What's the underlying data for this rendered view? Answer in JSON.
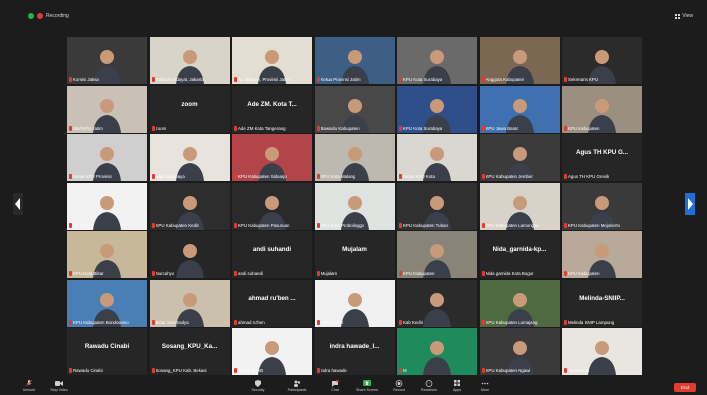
{
  "recording": {
    "label": "Recording"
  },
  "view": {
    "label": "View"
  },
  "participants": [
    {
      "name": "Komisi Jaksa",
      "display": "",
      "bg": "#3a3a3a"
    },
    {
      "name": "Rahmat Hidayat, Jakarta",
      "display": "",
      "bg": "#d9d4ca"
    },
    {
      "name": "AL Wilayah, Provinsi Jatim",
      "display": "",
      "bg": "#e3ddd2"
    },
    {
      "name": "Ketua Provinsi Jatim",
      "display": "",
      "bg": "#3d5f86"
    },
    {
      "name": "KPU Kota Surabaya",
      "display": "",
      "bg": "#6a6a6a"
    },
    {
      "name": "Anggota Kabupaten",
      "display": "",
      "bg": "#7c6852"
    },
    {
      "name": "Sekretaris KPU",
      "display": "",
      "bg": "#2b2b2b"
    },
    {
      "name": "Staf KPU Jatim",
      "display": "",
      "bg": "#c9c1b5"
    },
    {
      "name": "zoom",
      "display": "zoom",
      "bg": "#262626"
    },
    {
      "name": "Ade ZM Kota Tangerang",
      "display": "Ade ZM. Kota T...",
      "bg": "#262626"
    },
    {
      "name": "Bawaslu Kabupaten",
      "display": "",
      "bg": "#484848"
    },
    {
      "name": "KPU Kota Surabaya",
      "display": "",
      "bg": "#2f4f8a"
    },
    {
      "name": "KPU Jawa Barat",
      "display": "",
      "bg": "#3f70b0"
    },
    {
      "name": "KPU Kabupaten",
      "display": "",
      "bg": "#9b8f80"
    },
    {
      "name": "Ketua KPU Provinsi",
      "display": "",
      "bg": "#cfcfcf"
    },
    {
      "name": "Iwan Surabaya",
      "display": "",
      "bg": "#e8e3dc"
    },
    {
      "name": "KPU Kabupaten Sidoarjo",
      "display": "",
      "bg": "#b2444a"
    },
    {
      "name": "KPU Kota Malang",
      "display": "",
      "bg": "#bdb8b0"
    },
    {
      "name": "Ketua KPU Kota",
      "display": "",
      "bg": "#dad6d0"
    },
    {
      "name": "KPU Kabupaten Jember",
      "display": "",
      "bg": "#3b3b3b"
    },
    {
      "name": "Agus TH KPU Gresik",
      "display": "Agus TH KPU G...",
      "bg": "#262626"
    },
    {
      "name": "KPU RI",
      "display": "",
      "bg": "#f2f2f2"
    },
    {
      "name": "KPU Kabupaten Kediri",
      "display": "",
      "bg": "#2d2d2d"
    },
    {
      "name": "KPU Kabupaten Pasuruan",
      "display": "",
      "bg": "#2a2a2a"
    },
    {
      "name": "KPU Kota Probolinggo",
      "display": "",
      "bg": "#dfe3df"
    },
    {
      "name": "KPU Kabupaten Tuban",
      "display": "",
      "bg": "#303030"
    },
    {
      "name": "KPU Kabupaten Lamongan",
      "display": "",
      "bg": "#d8d2c8"
    },
    {
      "name": "KPU Kabupaten Mojokerto",
      "display": "",
      "bg": "#3a3a3a"
    },
    {
      "name": "KPU Kota Blitar",
      "display": "",
      "bg": "#c8b89a"
    },
    {
      "name": "Nurcahyo",
      "display": "",
      "bg": "#262626"
    },
    {
      "name": "andi suhandi",
      "display": "andi suhandi",
      "bg": "#262626"
    },
    {
      "name": "Mujalam",
      "display": "Mujalam",
      "bg": "#262626"
    },
    {
      "name": "KPU Kabupaten",
      "display": "",
      "bg": "#8a8378"
    },
    {
      "name": "Nida garnida Kota Bogor",
      "display": "Nida_garnida-kp...",
      "bg": "#262626"
    },
    {
      "name": "KPU Kabupaten",
      "display": "",
      "bg": "#b8a99a"
    },
    {
      "name": "KPU Kabupaten Bondowoso",
      "display": "",
      "bg": "#4a7fb5"
    },
    {
      "name": "Bidar Sinkmadya",
      "display": "",
      "bg": "#cbbfae"
    },
    {
      "name": "ahmad ru'ben",
      "display": "ahmad ru'ben ...",
      "bg": "#262626"
    },
    {
      "name": "Teknis KPU",
      "display": "",
      "bg": "#f0f0f0"
    },
    {
      "name": "Kab Kediri",
      "display": "",
      "bg": "#2b2b2b"
    },
    {
      "name": "KPU Kabupaten Lumajang",
      "display": "",
      "bg": "#4f6a3e"
    },
    {
      "name": "Melinda SNIP Lampung",
      "display": "Melinda-SNIIP...",
      "bg": "#262626"
    },
    {
      "name": "Rawadu Cinabi",
      "display": "Rawadu Cinabi",
      "bg": "#262626"
    },
    {
      "name": "Sosang_KPU Kab. Bekasi",
      "display": "Sosang_KPU_Ka...",
      "bg": "#262626"
    },
    {
      "name": "S.A.R. STAB",
      "display": "",
      "bg": "#f2f2f2"
    },
    {
      "name": "indra hawade",
      "display": "indra hawade_I...",
      "bg": "#262626"
    },
    {
      "name": "M",
      "display": "",
      "bg": "#1f8a5b"
    },
    {
      "name": "KPU Kabupaten Ngawi",
      "display": "",
      "bg": "#3a3a3a"
    },
    {
      "name": "Sekretariat",
      "display": "",
      "bg": "#e9e6e0"
    }
  ],
  "toolbar": {
    "unmute": "Unmute",
    "stop_video": "Stop Video",
    "security": "Security",
    "participants": "Participants",
    "participants_count": "59",
    "chat": "Chat",
    "share_screen": "Share Screen",
    "record": "Record",
    "reactions": "Reactions",
    "apps": "Apps",
    "more": "More",
    "end": "End"
  },
  "colors": {
    "background": "#1c1c1c",
    "tile": "#262626",
    "mic_muted": "#e03c31",
    "share_green": "#2db34a",
    "end_red": "#e03c31"
  }
}
